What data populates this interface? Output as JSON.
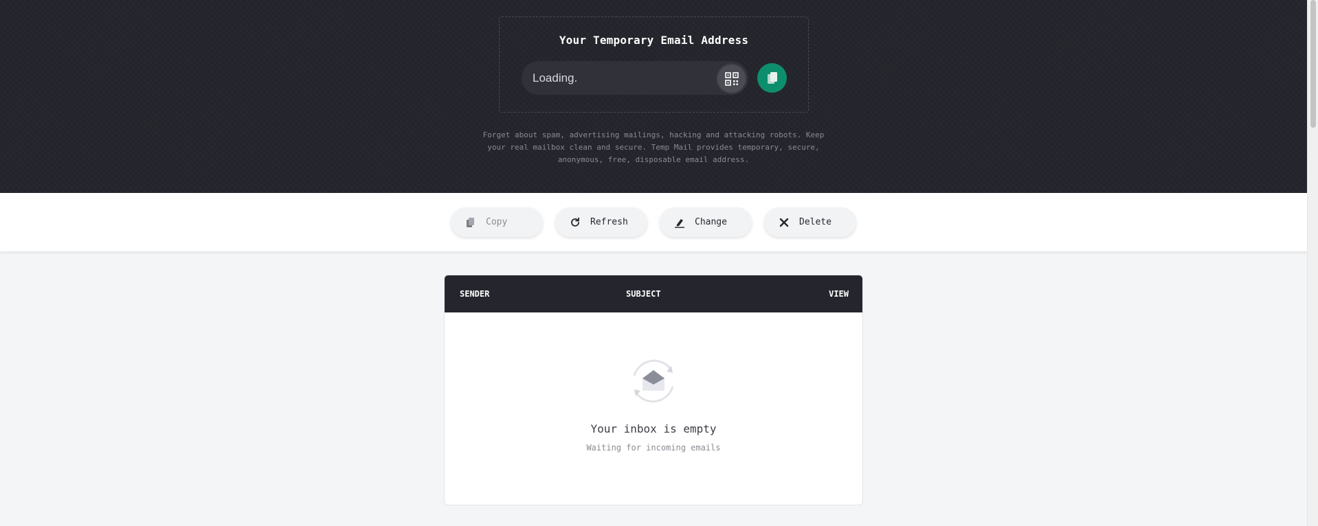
{
  "hero": {
    "title": "Your Temporary Email Address",
    "email_value": "Loading.",
    "description": "Forget about spam, advertising mailings, hacking and attacking robots. Keep your real mailbox clean and secure. Temp Mail provides temporary, secure, anonymous, free, disposable email address.",
    "qr_icon": "qr-code-icon",
    "copy_icon": "copy-icon",
    "accent_color": "#0d8f6e",
    "background_color": "#25262d"
  },
  "actions": {
    "copy": {
      "label": "Copy",
      "icon": "copy-icon",
      "state": "disabled"
    },
    "refresh": {
      "label": "Refresh",
      "icon": "refresh-icon"
    },
    "change": {
      "label": "Change",
      "icon": "edit-icon"
    },
    "delete": {
      "label": "Delete",
      "icon": "close-icon"
    }
  },
  "inbox": {
    "columns": [
      "SENDER",
      "SUBJECT",
      "VIEW"
    ],
    "empty_title": "Your inbox is empty",
    "empty_subtitle": "Waiting for incoming emails",
    "empty_icon": "envelope-refresh-icon"
  }
}
